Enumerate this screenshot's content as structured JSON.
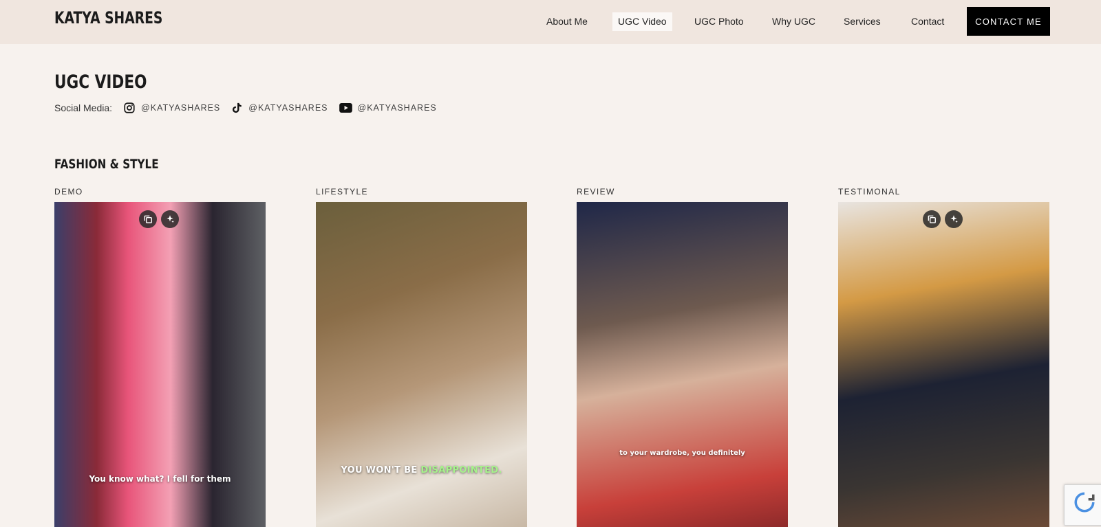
{
  "header": {
    "logo": "KATYA SHARES",
    "nav": [
      "About Me",
      "UGC Video",
      "UGC Photo",
      "Why UGC",
      "Services",
      "Contact"
    ],
    "active_nav": "UGC Video",
    "cta_label": "CONTACT ME"
  },
  "page": {
    "title": "UGC VIDEO",
    "social_label": "Social Media:",
    "social": [
      {
        "icon": "instagram-icon",
        "handle": "@KATYASHARES"
      },
      {
        "icon": "tiktok-icon",
        "handle": "@KATYASHARES"
      },
      {
        "icon": "youtube-icon",
        "handle": "@KATYASHARES"
      }
    ]
  },
  "section": {
    "title": "FASHION & STYLE",
    "cards": [
      {
        "label": "DEMO",
        "caption": "You know what? I fell for them"
      },
      {
        "label": "LIFESTYLE",
        "caption_part1": "YOU WON'T BE ",
        "caption_part2": "DISAPPOINTED."
      },
      {
        "label": "REVIEW",
        "caption": "to your wardrobe, you definitely"
      },
      {
        "label": "TESTIMONAL",
        "caption": ""
      }
    ]
  },
  "colors": {
    "accent": "#000000",
    "header_bg": "#f0e6df",
    "page_bg": "#f7f2ee",
    "highlight_green": "#a6f28b"
  }
}
